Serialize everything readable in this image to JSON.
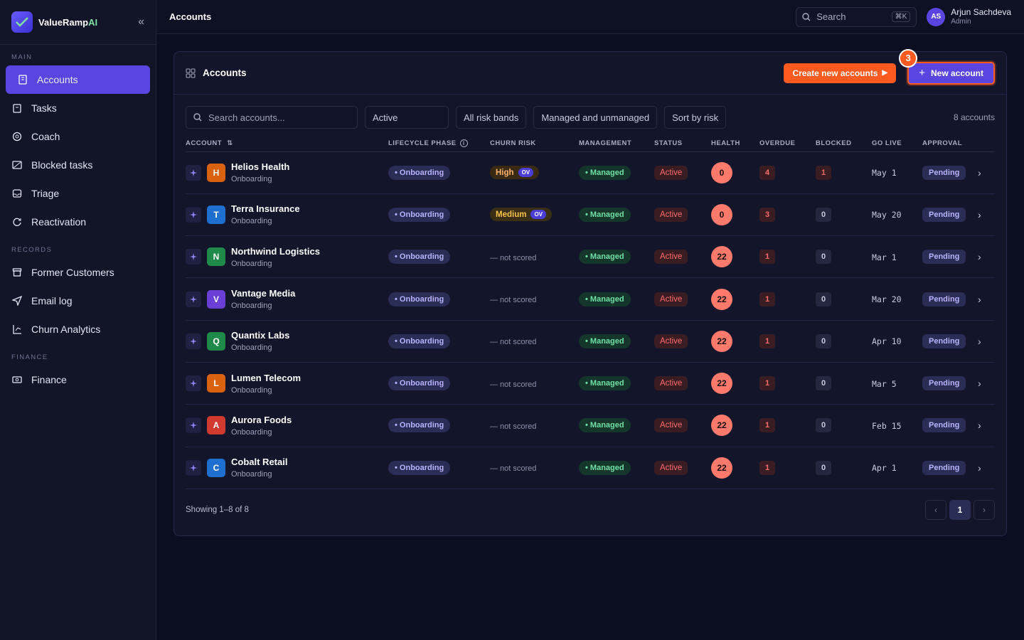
{
  "brand": {
    "name": "ValueRamp",
    "suffix": "AI"
  },
  "sidebar": {
    "main_label": "MAIN",
    "main_items": [
      {
        "label": "Accounts",
        "icon": "building-icon",
        "active": true
      },
      {
        "label": "Tasks",
        "icon": "clipboard-icon"
      },
      {
        "label": "Coach",
        "icon": "target-icon"
      },
      {
        "label": "Blocked tasks",
        "icon": "ban-icon"
      },
      {
        "label": "Triage",
        "icon": "inbox-icon"
      },
      {
        "label": "Reactivation",
        "icon": "refresh-icon"
      }
    ],
    "records_label": "RECORDS",
    "records_items": [
      {
        "label": "Former Customers",
        "icon": "archive-icon"
      },
      {
        "label": "Email log",
        "icon": "send-icon"
      },
      {
        "label": "Churn Analytics",
        "icon": "chart-icon"
      }
    ],
    "finance_label": "FINANCE",
    "finance_items": [
      {
        "label": "Finance",
        "icon": "money-icon"
      }
    ]
  },
  "topbar": {
    "title": "Accounts",
    "search_placeholder": "Search",
    "shortcut": "⌘K",
    "user": {
      "initials": "AS",
      "name": "Arjun Sachdeva",
      "role": "Admin"
    }
  },
  "card": {
    "title": "Accounts",
    "create_label": "Create new accounts",
    "new_label": "New account",
    "step_number": "3"
  },
  "filters": {
    "search_placeholder": "Search accounts...",
    "lifecycle": "Active",
    "risk": "All risk bands",
    "management": "Managed and unmanaged",
    "sort": "Sort by risk",
    "count": "8 accounts"
  },
  "columns": [
    "ACCOUNT",
    "LIFECYCLE PHASE",
    "CHURN RISK",
    "MANAGEMENT",
    "STATUS",
    "HEALTH",
    "OVERDUE",
    "BLOCKED",
    "GO LIVE",
    "APPROVAL"
  ],
  "rows": [
    {
      "letter": "H",
      "color": "#d9620f",
      "name": "Helios Health",
      "sub": "Onboarding",
      "phase": "Onboarding",
      "risk": "High",
      "risk_kind": "high",
      "ov": "OV",
      "mgmt": "Managed",
      "status": "Active",
      "health": "0",
      "overdue": "4",
      "blocked": "1",
      "blocked_red": true,
      "golive": "May 1",
      "approval": "Pending"
    },
    {
      "letter": "T",
      "color": "#1f6fd1",
      "name": "Terra Insurance",
      "sub": "Onboarding",
      "phase": "Onboarding",
      "risk": "Medium",
      "risk_kind": "med",
      "ov": "OV",
      "mgmt": "Managed",
      "status": "Active",
      "health": "0",
      "overdue": "3",
      "blocked": "0",
      "blocked_red": false,
      "golive": "May 20",
      "approval": "Pending"
    },
    {
      "letter": "N",
      "color": "#1f8a4a",
      "name": "Northwind Logistics",
      "sub": "Onboarding",
      "phase": "Onboarding",
      "risk": "— not scored",
      "risk_kind": "none",
      "mgmt": "Managed",
      "status": "Active",
      "health": "22",
      "overdue": "1",
      "blocked": "0",
      "blocked_red": false,
      "golive": "Mar 1",
      "approval": "Pending"
    },
    {
      "letter": "V",
      "color": "#6a3fd6",
      "name": "Vantage Media",
      "sub": "Onboarding",
      "phase": "Onboarding",
      "risk": "— not scored",
      "risk_kind": "none",
      "mgmt": "Managed",
      "status": "Active",
      "health": "22",
      "overdue": "1",
      "blocked": "0",
      "blocked_red": false,
      "golive": "Mar 20",
      "approval": "Pending"
    },
    {
      "letter": "Q",
      "color": "#1f8a4a",
      "name": "Quantix Labs",
      "sub": "Onboarding",
      "phase": "Onboarding",
      "risk": "— not scored",
      "risk_kind": "none",
      "mgmt": "Managed",
      "status": "Active",
      "health": "22",
      "overdue": "1",
      "blocked": "0",
      "blocked_red": false,
      "golive": "Apr 10",
      "approval": "Pending"
    },
    {
      "letter": "L",
      "color": "#d9620f",
      "name": "Lumen Telecom",
      "sub": "Onboarding",
      "phase": "Onboarding",
      "risk": "— not scored",
      "risk_kind": "none",
      "mgmt": "Managed",
      "status": "Active",
      "health": "22",
      "overdue": "1",
      "blocked": "0",
      "blocked_red": false,
      "golive": "Mar 5",
      "approval": "Pending"
    },
    {
      "letter": "A",
      "color": "#d13a2e",
      "name": "Aurora Foods",
      "sub": "Onboarding",
      "phase": "Onboarding",
      "risk": "— not scored",
      "risk_kind": "none",
      "mgmt": "Managed",
      "status": "Active",
      "health": "22",
      "overdue": "1",
      "blocked": "0",
      "blocked_red": false,
      "golive": "Feb 15",
      "approval": "Pending"
    },
    {
      "letter": "C",
      "color": "#1f6fd1",
      "name": "Cobalt Retail",
      "sub": "Onboarding",
      "phase": "Onboarding",
      "risk": "— not scored",
      "risk_kind": "none",
      "mgmt": "Managed",
      "status": "Active",
      "health": "22",
      "overdue": "1",
      "blocked": "0",
      "blocked_red": false,
      "golive": "Apr 1",
      "approval": "Pending"
    }
  ],
  "footer": {
    "showing": "Showing 1–8 of 8",
    "page": "1"
  }
}
